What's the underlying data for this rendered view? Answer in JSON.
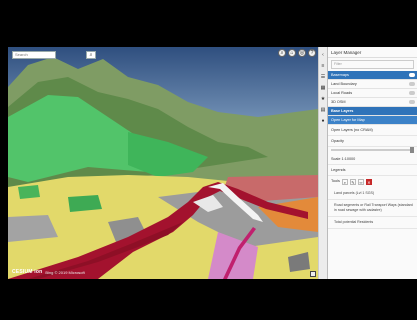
{
  "map": {
    "search_placeholder": "Search",
    "search_icon": "search-icon",
    "controls": [
      "search-icon",
      "home-icon",
      "globe-icon",
      "help-icon"
    ],
    "credit_logo": "CESIUM ion",
    "credit_text": "Bing  © 2019 Microsoft"
  },
  "rail": {
    "icons": [
      "chevron-left-icon",
      "layers-icon",
      "list-icon",
      "grid-icon",
      "star-icon",
      "map-icon",
      "pin-icon"
    ]
  },
  "panel": {
    "title": "Layer Manager",
    "filter_placeholder": "Filter",
    "base_rows": [
      {
        "label": "Basemaps",
        "active": true
      },
      {
        "label": "Land Boundary",
        "active": false
      },
      {
        "label": "Local Roads",
        "active": false
      },
      {
        "label": "3D OSM",
        "active": false
      }
    ],
    "section_title": "Base Layers",
    "section_sub": "Open Layer for Map",
    "item_open": "Open Layers (no CRAM)",
    "opacity_label": "Opacity",
    "scale_label": "Scale 1:10000",
    "legend_label": "Legends",
    "tools_label": "Tools",
    "tool_icons": [
      "zoom-icon",
      "edit-icon",
      "link-icon",
      "delete-icon"
    ],
    "sub_items": [
      "Land parcels (Lvl 1 SGS)",
      "Road segments or Rail Transport Ways (standard in road sewage with cadastre)",
      "Total potential Residents"
    ]
  }
}
